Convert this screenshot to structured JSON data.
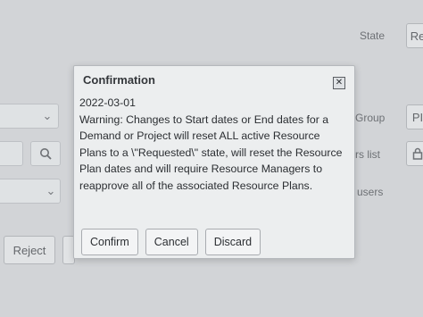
{
  "background": {
    "top_right_label": "State",
    "top_right_btn": "Re",
    "right_labels": [
      "Group",
      "rs list",
      "users"
    ],
    "right_btn_label": "PI",
    "reject_label": "Reject"
  },
  "dialog": {
    "title": "Confirmation",
    "date": "2022-03-01",
    "message": "Warning: Changes to Start dates or End dates for a Demand or Project will reset ALL active Resource Plans to a \\\"Requested\\\" state, will reset the Resource Plan dates and will require Resource Managers to reapprove all of the associated Resource Plans.",
    "buttons": {
      "confirm": "Confirm",
      "cancel": "Cancel",
      "discard": "Discard"
    }
  },
  "icons": {
    "close": "close-icon",
    "search": "search-icon",
    "chevron": "chevron-down-icon",
    "lock": "lock-icon"
  }
}
